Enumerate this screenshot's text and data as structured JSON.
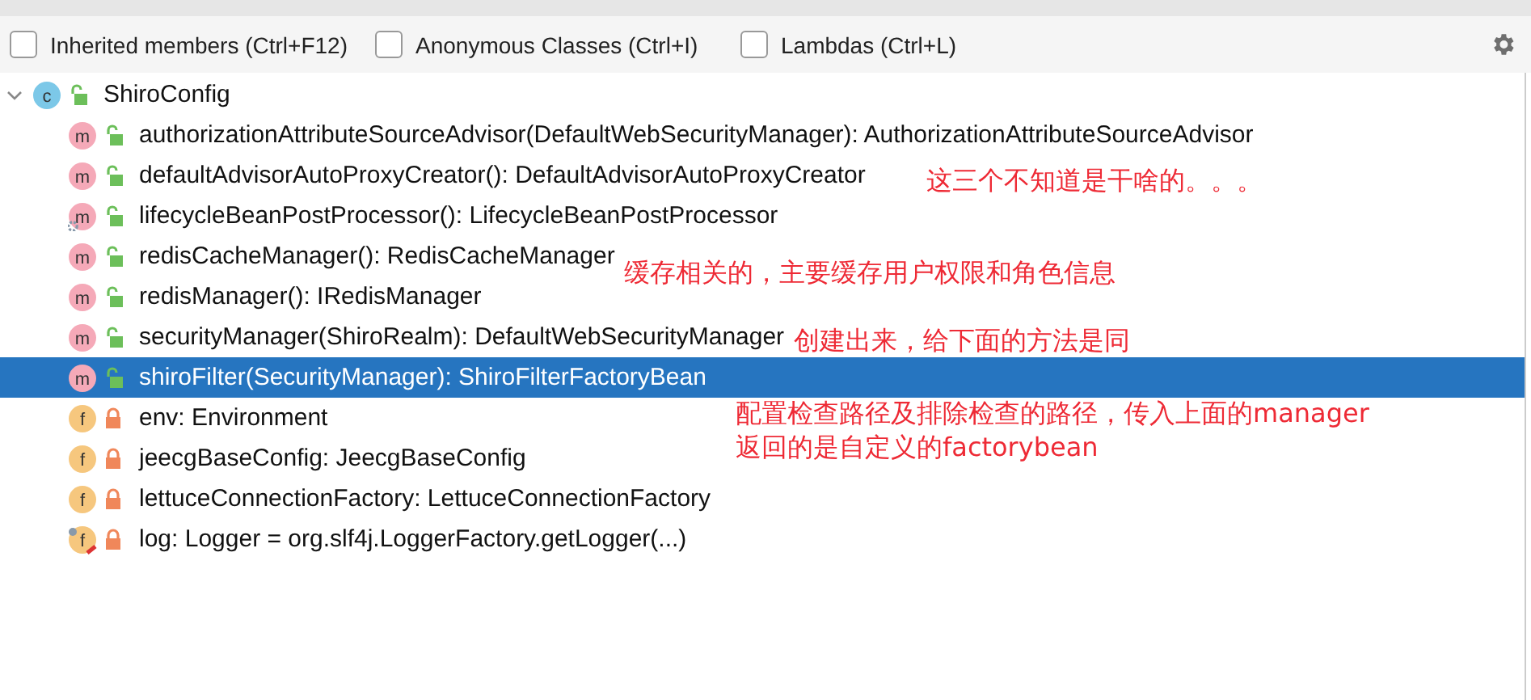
{
  "toolbar": {
    "options": [
      {
        "label": "Inherited members (Ctrl+F12)",
        "checked": false
      },
      {
        "label": "Anonymous Classes (Ctrl+I)",
        "checked": false
      },
      {
        "label": "Lambdas (Ctrl+L)",
        "checked": false
      }
    ]
  },
  "tree": {
    "label": "ShiroConfig",
    "kind": "class",
    "letter": "c",
    "locked": false,
    "expanded": true,
    "selected": false,
    "children": [
      {
        "label": "authorizationAttributeSourceAdvisor(DefaultWebSecurityManager): AuthorizationAttributeSourceAdvisor",
        "kind": "method",
        "letter": "m",
        "locked": false,
        "selected": false
      },
      {
        "label": "defaultAdvisorAutoProxyCreator(): DefaultAdvisorAutoProxyCreator",
        "kind": "method",
        "letter": "m",
        "locked": false,
        "selected": false
      },
      {
        "label": "lifecycleBeanPostProcessor(): LifecycleBeanPostProcessor",
        "kind": "method",
        "letter": "m",
        "locked": false,
        "gear_overlay": true,
        "selected": false
      },
      {
        "label": "redisCacheManager(): RedisCacheManager",
        "kind": "method",
        "letter": "m",
        "locked": false,
        "selected": false
      },
      {
        "label": "redisManager(): IRedisManager",
        "kind": "method",
        "letter": "m",
        "locked": false,
        "selected": false
      },
      {
        "label": "securityManager(ShiroRealm): DefaultWebSecurityManager",
        "kind": "method",
        "letter": "m",
        "locked": false,
        "selected": false
      },
      {
        "label": "shiroFilter(SecurityManager): ShiroFilterFactoryBean",
        "kind": "method",
        "letter": "m",
        "locked": false,
        "selected": true
      },
      {
        "label": "env: Environment",
        "kind": "field",
        "letter": "f",
        "locked": true,
        "selected": false
      },
      {
        "label": "jeecgBaseConfig: JeecgBaseConfig",
        "kind": "field",
        "letter": "f",
        "locked": true,
        "selected": false
      },
      {
        "label": "lettuceConnectionFactory: LettuceConnectionFactory",
        "kind": "field",
        "letter": "f",
        "locked": true,
        "selected": false
      },
      {
        "label": "log: Logger = org.slf4j.LoggerFactory.getLogger(...)",
        "kind": "field",
        "letter": "f",
        "locked": true,
        "static_overlay": true,
        "selected": false
      }
    ]
  },
  "annotations": [
    "这三个不知道是干啥的。。。",
    "缓存相关的，主要缓存用户权限和角色信息",
    "创建出来，给下面的方法是同",
    "配置检查路径及排除检查的路径，传入上面的manager",
    "返回的是自定义的factorybean"
  ]
}
